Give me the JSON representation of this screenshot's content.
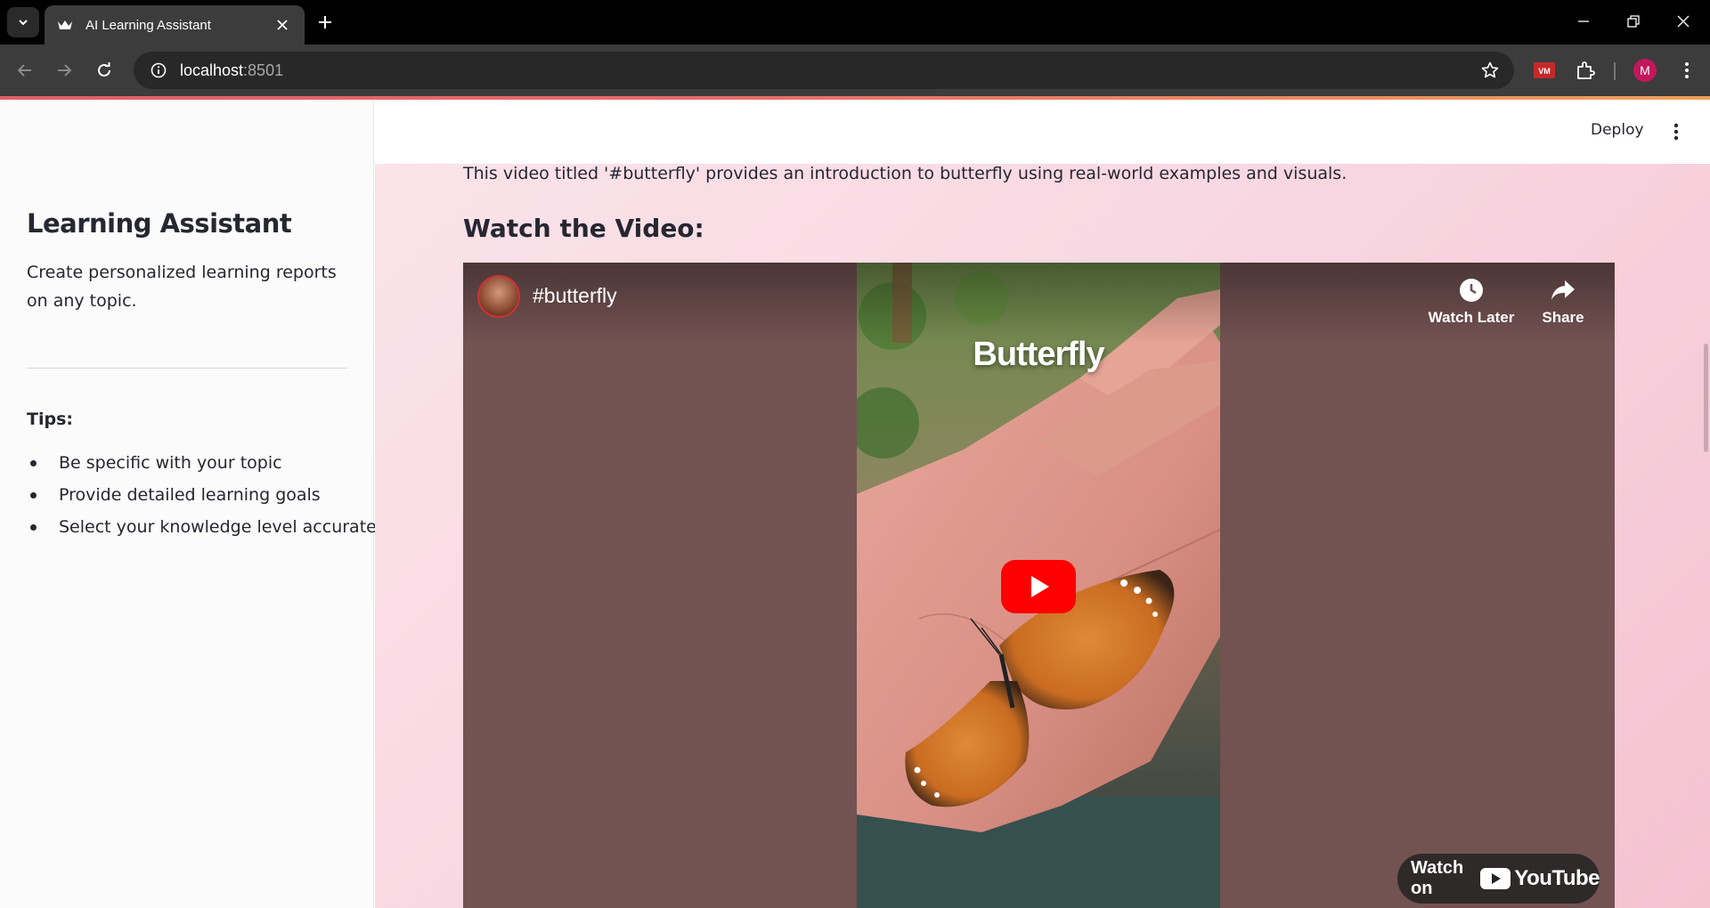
{
  "browser": {
    "tab_title": "AI Learning Assistant",
    "url_host": "localhost",
    "url_port": ":8501",
    "avatar_letter": "M",
    "extension_label": "VM"
  },
  "sidebar": {
    "title": "Learning Assistant",
    "description": "Create personalized learning reports on any topic.",
    "tips_heading": "Tips:",
    "tips": [
      "Be specific with your topic",
      "Provide detailed learning goals",
      "Select your knowledge level accurately"
    ]
  },
  "header": {
    "deploy_label": "Deploy"
  },
  "main": {
    "intro_text": "This video titled '#butterfly' provides an introduction to butterfly using real-world examples and visuals.",
    "watch_heading": "Watch the Video:"
  },
  "video": {
    "title": "#butterfly",
    "overlay_text": "Butterfly",
    "watch_later_label": "Watch Later",
    "share_label": "Share",
    "watch_on_label": "Watch on",
    "youtube_label": "YouTube"
  },
  "colors": {
    "accent": "#ff0000",
    "main_bg": "#f8d6e1",
    "video_letterbox": "#735252",
    "avatar": "#c2185b"
  }
}
